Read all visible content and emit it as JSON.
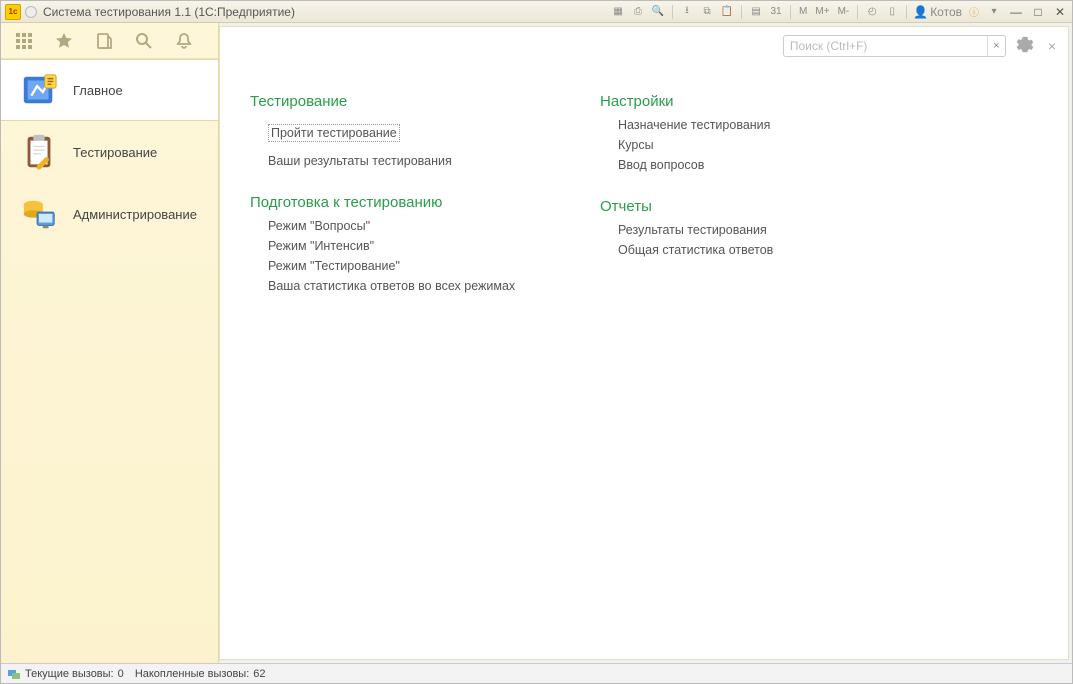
{
  "titlebar": {
    "title": "Система тестирования 1.1  (1С:Предприятие)",
    "user": "Котов"
  },
  "sidebar": {
    "items": [
      {
        "label": "Главное",
        "active": true
      },
      {
        "label": "Тестирование",
        "active": false
      },
      {
        "label": "Администрирование",
        "active": false
      }
    ]
  },
  "search": {
    "placeholder": "Поиск (Ctrl+F)",
    "value": ""
  },
  "sections": {
    "left": [
      {
        "title": "Тестирование",
        "links": [
          {
            "label": "Пройти тестирование",
            "boxed": true
          },
          {
            "label": "Ваши результаты тестирования"
          }
        ]
      },
      {
        "title": "Подготовка к тестированию",
        "links": [
          {
            "label": "Режим \"Вопросы\""
          },
          {
            "label": "Режим \"Интенсив\""
          },
          {
            "label": "Режим \"Тестирование\""
          },
          {
            "label": "Ваша статистика ответов во всех режимах"
          }
        ]
      }
    ],
    "right": [
      {
        "title": "Настройки",
        "links": [
          {
            "label": "Назначение тестирования"
          },
          {
            "label": "Курсы"
          },
          {
            "label": "Ввод вопросов"
          }
        ]
      },
      {
        "title": "Отчеты",
        "links": [
          {
            "label": "Результаты тестирования"
          },
          {
            "label": "Общая статистика ответов"
          }
        ]
      }
    ]
  },
  "statusbar": {
    "current_label": "Текущие вызовы:",
    "current_value": "0",
    "accum_label": "Накопленные вызовы:",
    "accum_value": "62"
  }
}
